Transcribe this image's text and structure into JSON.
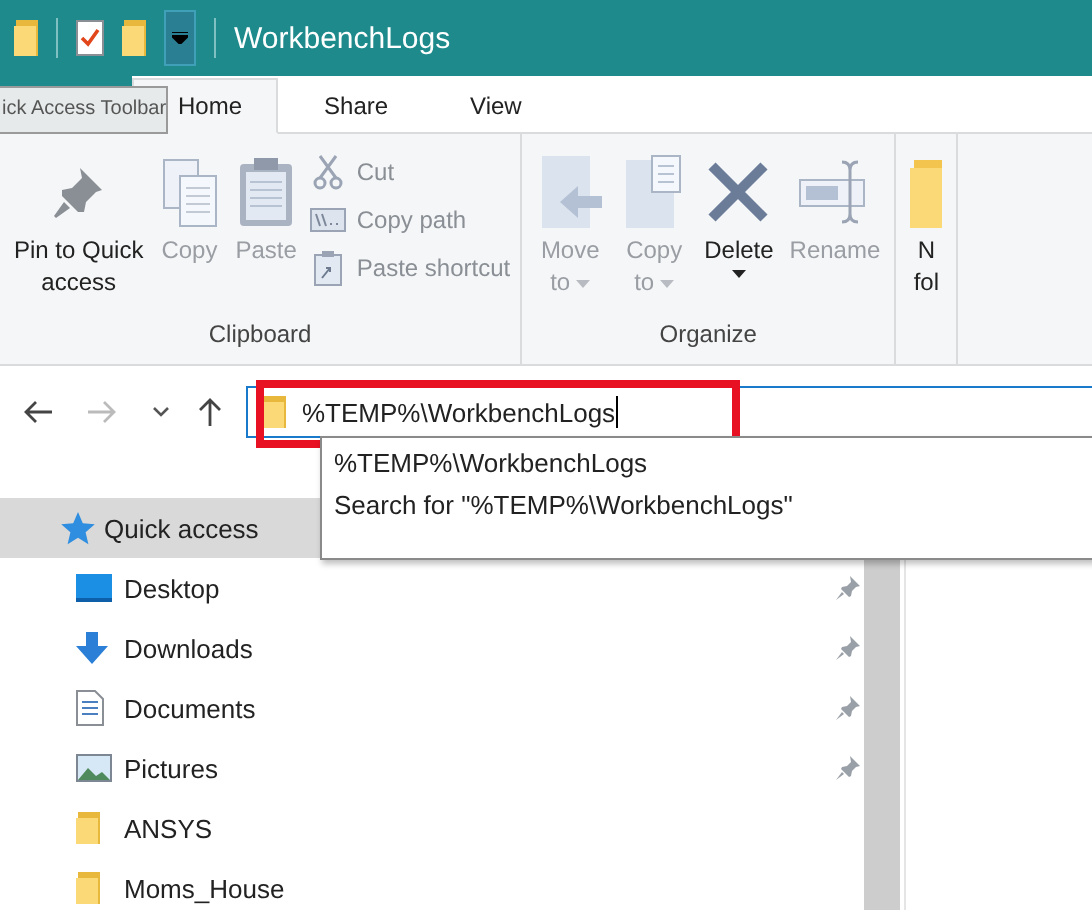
{
  "window": {
    "title": "WorkbenchLogs"
  },
  "tooltip": {
    "text": "ick Access Toolbar"
  },
  "tabs": [
    {
      "label": "Home",
      "selected": true
    },
    {
      "label": "Share",
      "selected": false
    },
    {
      "label": "View",
      "selected": false
    }
  ],
  "ribbon": {
    "groups": [
      {
        "label": "Clipboard",
        "buttons": [
          {
            "kind": "large",
            "lines": [
              "Pin to Quick",
              "access"
            ],
            "disabled": false,
            "dropdown": false
          },
          {
            "kind": "large",
            "lines": [
              "Copy"
            ],
            "disabled": true,
            "dropdown": false
          },
          {
            "kind": "large",
            "lines": [
              "Paste"
            ],
            "disabled": true,
            "dropdown": false
          },
          {
            "kind": "small",
            "lines": [
              "Cut"
            ],
            "disabled": true
          },
          {
            "kind": "small",
            "lines": [
              "Copy path"
            ],
            "disabled": true
          },
          {
            "kind": "small",
            "lines": [
              "Paste shortcut"
            ],
            "disabled": true
          }
        ]
      },
      {
        "label": "Organize",
        "buttons": [
          {
            "kind": "large",
            "lines": [
              "Move",
              "to"
            ],
            "disabled": true,
            "dropdown": true
          },
          {
            "kind": "large",
            "lines": [
              "Copy",
              "to"
            ],
            "disabled": true,
            "dropdown": true
          },
          {
            "kind": "large",
            "lines": [
              "Delete"
            ],
            "disabled": false,
            "dropdown": true
          },
          {
            "kind": "large",
            "lines": [
              "Rename"
            ],
            "disabled": true,
            "dropdown": false
          }
        ]
      },
      {
        "buttons": [
          {
            "kind": "large",
            "lines": [
              "N",
              "fol"
            ],
            "disabled": false,
            "dropdown": false
          }
        ]
      }
    ]
  },
  "address": {
    "value": "%TEMP%\\WorkbenchLogs",
    "suggestions": [
      "%TEMP%\\WorkbenchLogs",
      "Search for \"%TEMP%\\WorkbenchLogs\""
    ]
  },
  "nav": {
    "items": [
      {
        "label": "Quick access",
        "selected": true,
        "pinned": false
      },
      {
        "label": "Desktop",
        "selected": false,
        "pinned": true
      },
      {
        "label": "Downloads",
        "selected": false,
        "pinned": true
      },
      {
        "label": "Documents",
        "selected": false,
        "pinned": true
      },
      {
        "label": "Pictures",
        "selected": false,
        "pinned": true
      },
      {
        "label": "ANSYS",
        "selected": false,
        "pinned": false
      },
      {
        "label": "Moms_House",
        "selected": false,
        "pinned": false
      }
    ]
  }
}
